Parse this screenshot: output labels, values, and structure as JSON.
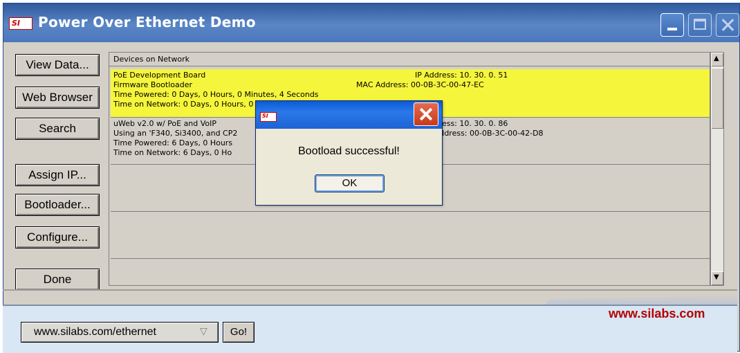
{
  "window": {
    "title": "Power Over Ethernet Demo",
    "logo_text": "SI"
  },
  "side_buttons": {
    "view_data": "View Data...",
    "web_browser": "Web Browser",
    "search": "Search",
    "assign_ip": "Assign IP...",
    "bootloader": "Bootloader...",
    "configure": "Configure...",
    "done": "Done"
  },
  "device_list": {
    "header": "Devices on Network",
    "devices": [
      {
        "name": "PoE Development Board",
        "type": "Firmware Bootloader",
        "time_powered": "Time Powered: 0 Days,  0 Hours,  0 Minutes,  4 Seconds",
        "time_on_network": "Time on Network: 0 Days,  0 Hours,  0 Minutes,  2 Seconds",
        "ip": "IP Address:  10. 30.  0. 51",
        "mac": "MAC Address:  00-0B-3C-00-47-EC",
        "highlight": "#f5f53c"
      },
      {
        "name": "uWeb v2.0 w/ PoE and VoIP",
        "type": "Using an 'F340, Si3400, and CP2",
        "time_powered": "Time Powered: 6 Days,  0 Hours",
        "time_on_network": "Time on Network: 6 Days,  0 Ho",
        "ip": "IP Address:  10. 30.  0. 86",
        "mac": "MAC Address:  00-0B-3C-00-42-D8",
        "highlight": "#d4d0c8"
      }
    ]
  },
  "footer": {
    "url_value": "www.silabs.com/ethernet",
    "go_label": "Go!",
    "brand": "www.silabs.com",
    "brand_color": "#b30000"
  },
  "dialog": {
    "logo_text": "SI",
    "message": "Bootload successful!",
    "ok_label": "OK"
  }
}
